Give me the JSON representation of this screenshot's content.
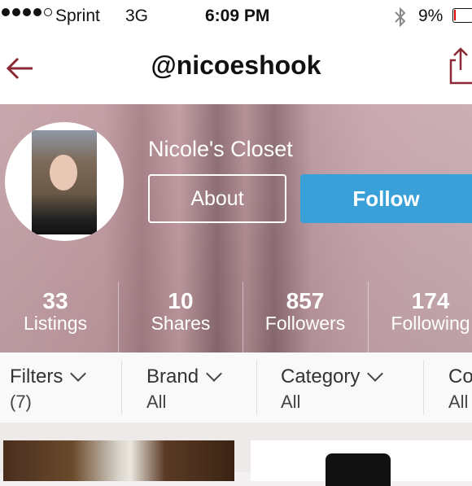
{
  "status_bar": {
    "carrier": "Sprint",
    "network": "3G",
    "time": "6:09 PM",
    "battery": "9%",
    "signal_bars_filled": 4,
    "signal_bars_total": 5
  },
  "nav": {
    "title": "@nicoeshook",
    "back_icon": "back-arrow-icon",
    "share_icon": "share-icon"
  },
  "profile": {
    "closet_name": "Nicole's Closet",
    "about_label": "About",
    "follow_label": "Follow"
  },
  "stats": [
    {
      "value": "33",
      "label": "Listings"
    },
    {
      "value": "10",
      "label": "Shares"
    },
    {
      "value": "857",
      "label": "Followers"
    },
    {
      "value": "174",
      "label": "Following"
    }
  ],
  "filters": [
    {
      "label": "Filters",
      "value": "(7)"
    },
    {
      "label": "Brand",
      "value": "All"
    },
    {
      "label": "Category",
      "value": "All"
    },
    {
      "label": "Co",
      "value": "All"
    }
  ],
  "colors": {
    "accent_follow": "#3aa0d8",
    "nav_icon": "#8b2a36",
    "header_tint": "#b8939a"
  }
}
